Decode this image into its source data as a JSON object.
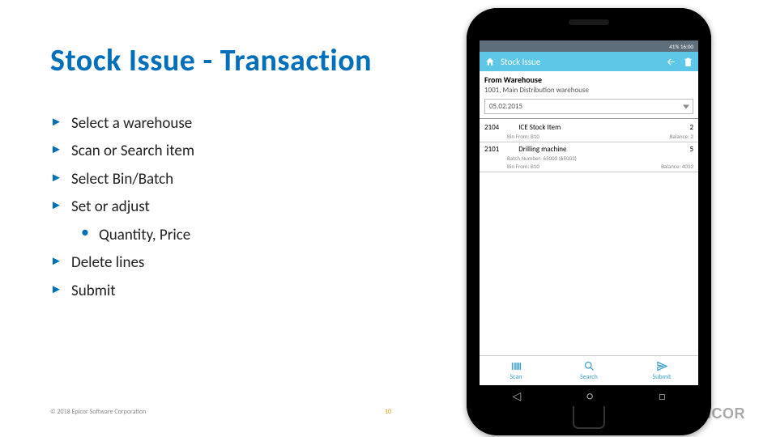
{
  "title": "Stock Issue - Transaction",
  "bullets": [
    {
      "text": "Select a warehouse"
    },
    {
      "text": "Scan or Search item"
    },
    {
      "text": "Select Bin/Batch"
    },
    {
      "text": "Set or adjust",
      "sub": [
        "Quantity, Price"
      ]
    },
    {
      "text": "Delete lines"
    },
    {
      "text": "Submit"
    }
  ],
  "footer": {
    "copyright": "© 2018 Epicor Software Corporation",
    "page": "10",
    "logo": "EPICOR"
  },
  "phone": {
    "status": {
      "left": "",
      "right": "41%  16:00"
    },
    "appbar": {
      "title": "Stock Issue"
    },
    "warehouse": {
      "label": "From Warehouse",
      "value": "1001, Main Distribution warehouse"
    },
    "date": "05.02.2015",
    "lines": [
      {
        "code": "2104",
        "name": "ICE Stock Item",
        "qty": "2",
        "binLabel": "Bin From:",
        "bin": "B10",
        "balLabel": "Balance:",
        "bal": "2"
      },
      {
        "code": "2101",
        "name": "Drilling machine",
        "qty": "5",
        "batchLabel": "Batch Number:",
        "batch": "65003 (65003)",
        "binLabel": "Bin From:",
        "bin": "B10",
        "balLabel": "Balance:",
        "bal": "4032"
      }
    ],
    "tabs": {
      "scan": "Scan",
      "search": "Search",
      "submit": "Submit"
    }
  }
}
